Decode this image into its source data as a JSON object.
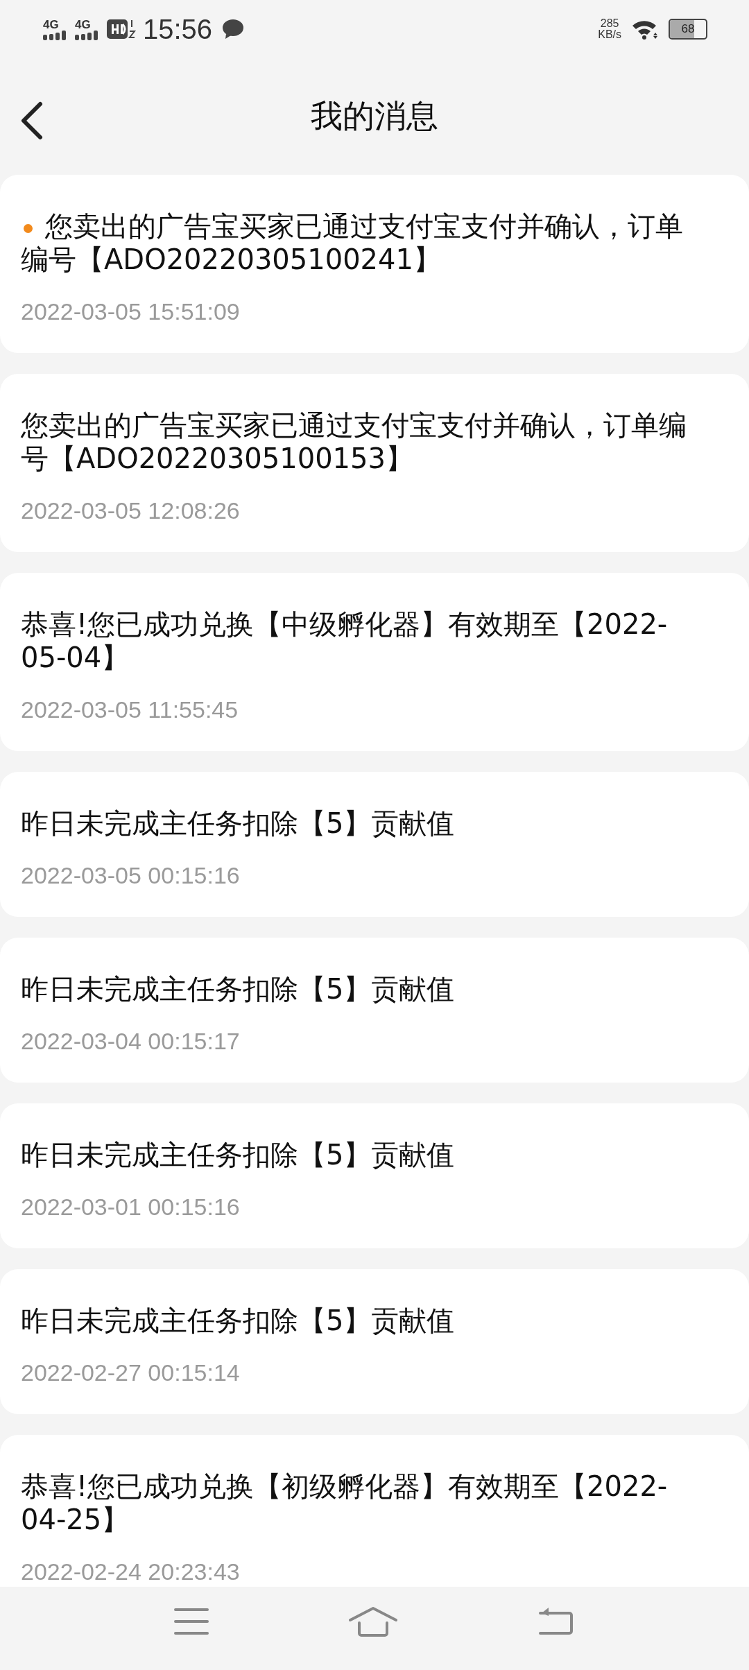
{
  "status_bar": {
    "networks": [
      "4G",
      "4G"
    ],
    "time": "15:56",
    "speed": "285",
    "speed_unit": "KB/s",
    "battery": "68"
  },
  "header": {
    "title": "我的消息"
  },
  "messages": [
    {
      "text": "您卖出的广告宝买家已通过支付宝支付并确认，订单编号【ADO20220305100241】",
      "time": "2022-03-05 15:51:09",
      "unread": true
    },
    {
      "text": "您卖出的广告宝买家已通过支付宝支付并确认，订单编号【ADO20220305100153】",
      "time": "2022-03-05 12:08:26",
      "unread": false
    },
    {
      "text": "恭喜!您已成功兑换【中级孵化器】有效期至【2022-05-04】",
      "time": "2022-03-05 11:55:45",
      "unread": false
    },
    {
      "text": "昨日未完成主任务扣除【5】贡献值",
      "time": "2022-03-05 00:15:16",
      "unread": false
    },
    {
      "text": "昨日未完成主任务扣除【5】贡献值",
      "time": "2022-03-04 00:15:17",
      "unread": false
    },
    {
      "text": "昨日未完成主任务扣除【5】贡献值",
      "time": "2022-03-01 00:15:16",
      "unread": false
    },
    {
      "text": "昨日未完成主任务扣除【5】贡献值",
      "time": "2022-02-27 00:15:14",
      "unread": false
    },
    {
      "text": "恭喜!您已成功兑换【初级孵化器】有效期至【2022-04-25】",
      "time": "2022-02-24 20:23:43",
      "unread": false
    }
  ]
}
